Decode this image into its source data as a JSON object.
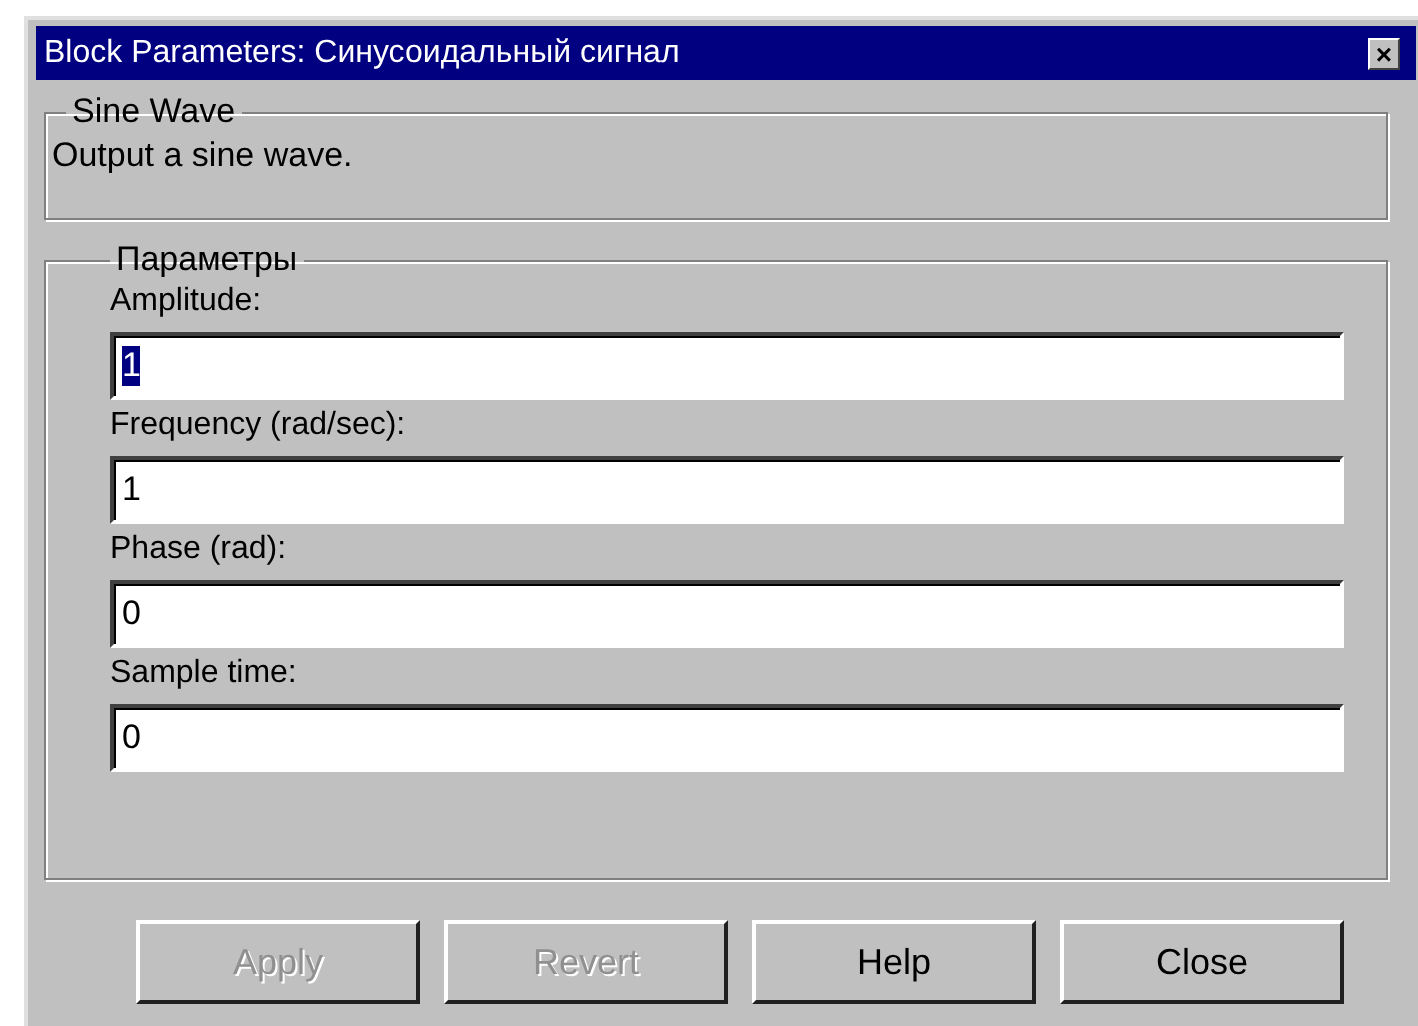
{
  "window": {
    "title": "Block Parameters: Синусоидальный  сигнал",
    "close": "×"
  },
  "description_group": {
    "title": "Sine Wave",
    "text": "Output a sine wave."
  },
  "parameters_group": {
    "title": "Параметры",
    "fields": [
      {
        "label": "Amplitude:",
        "value": "1",
        "text_selected": true
      },
      {
        "label": "Frequency (rad/sec):",
        "value": "1",
        "text_selected": false
      },
      {
        "label": "Phase (rad):",
        "value": "0",
        "text_selected": false
      },
      {
        "label": "Sample time:",
        "value": "0",
        "text_selected": false
      }
    ]
  },
  "buttons": [
    {
      "label": "Apply",
      "disabled": true
    },
    {
      "label": "Revert",
      "disabled": true
    },
    {
      "label": "Help",
      "disabled": false
    },
    {
      "label": "Close",
      "disabled": false
    }
  ]
}
